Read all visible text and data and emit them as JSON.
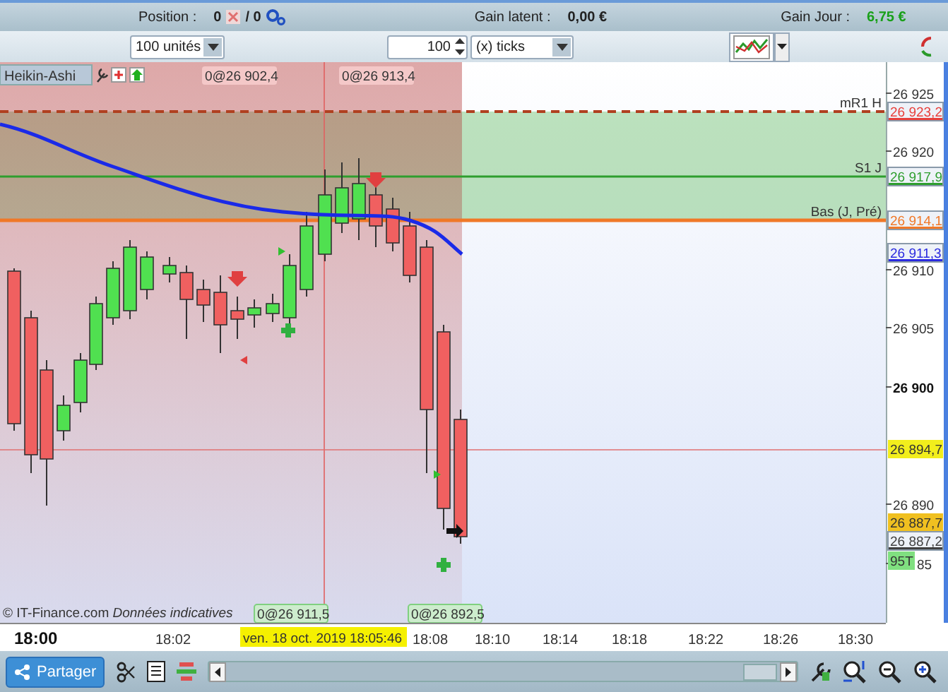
{
  "top_status": {
    "position_label": "Position :",
    "position_value": "0",
    "position_total": "/ 0",
    "gain_latent_label": "Gain latent :",
    "gain_latent_value": "0,00 €",
    "gain_jour_label": "Gain Jour :",
    "gain_jour_value": "6,75 €"
  },
  "toolbar": {
    "quantity_select": "100 unités",
    "offset_value": "100",
    "offset_unit_select": "(x) ticks"
  },
  "chart": {
    "style_label": "Heikin-Ashi",
    "top_labels": [
      "0@26 902,4",
      "0@26 913,4"
    ],
    "bottom_labels": [
      "0@26 911,5",
      "0@26 892,5"
    ],
    "notice": "© IT-Finance.com *Données indicatives*",
    "price_axis": [
      "26 925",
      "26 920",
      "26 910",
      "26 905",
      "26 900",
      "26 890",
      "85"
    ],
    "price_tags": [
      {
        "value": "26 923,2",
        "kind": "line",
        "color": "#e8403c",
        "line_label": "mR1 H"
      },
      {
        "value": "26 917,9",
        "kind": "line",
        "color": "#2e9e2e",
        "line_label": "S1 J"
      },
      {
        "value": "26 914,1",
        "kind": "line",
        "color": "#f07828",
        "line_label": "Bas (J, Pré)"
      },
      {
        "value": "26 911,3",
        "kind": "line",
        "color": "#2a2ae0"
      },
      {
        "value": "26 894,7",
        "kind": "highlight",
        "color": "#f2ee1c"
      },
      {
        "value": "26 887,7",
        "kind": "highlight",
        "color": "#f0c020"
      },
      {
        "value": "26 887,2",
        "kind": "line",
        "color": "#404040"
      },
      {
        "value": "95T",
        "kind": "highlight",
        "color": "#80e080"
      }
    ]
  },
  "time_axis": {
    "labels": [
      "18:00",
      "18:02",
      "18:08",
      "18:10",
      "18:14",
      "18:18",
      "18:22",
      "18:26",
      "18:30"
    ],
    "cursor_time": "ven. 18 oct. 2019 18:05:46"
  },
  "bottom_bar": {
    "share_button": "Partager"
  }
}
